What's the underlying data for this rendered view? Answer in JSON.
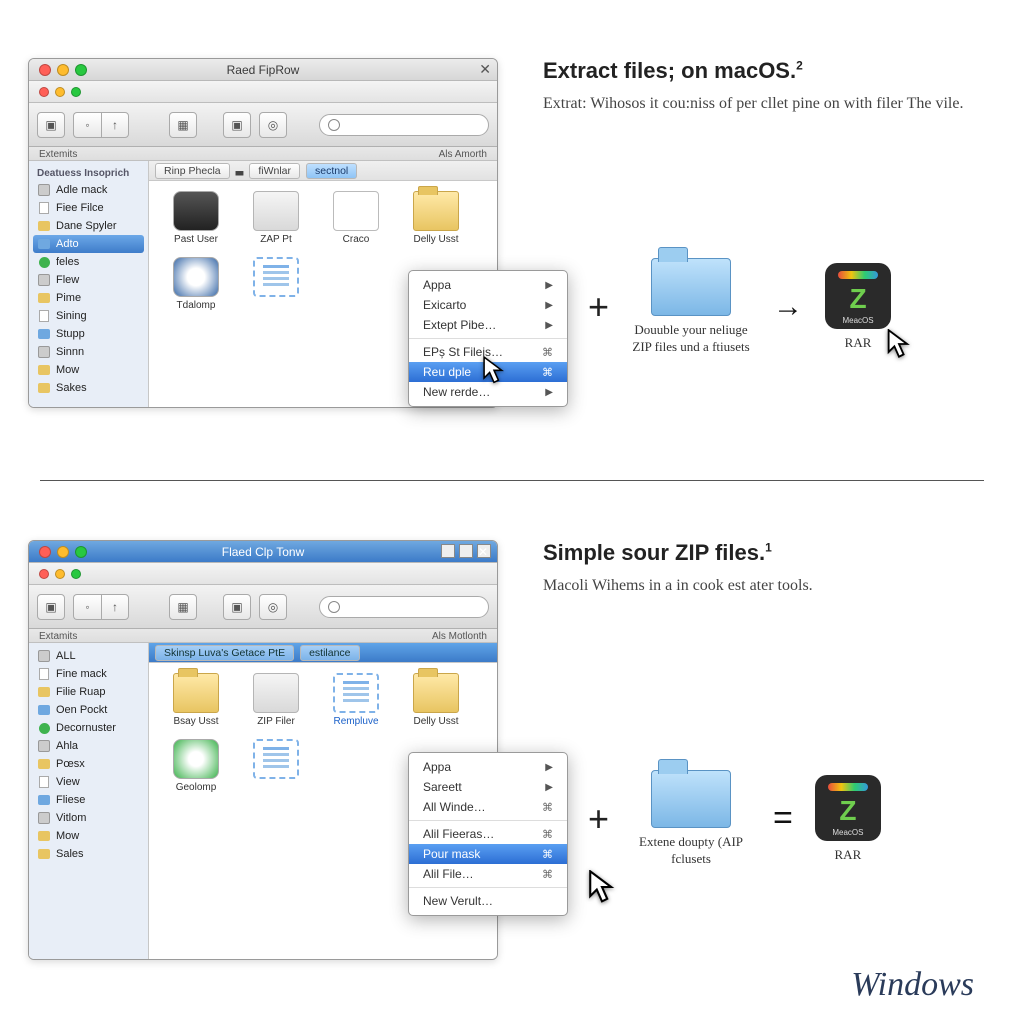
{
  "top": {
    "window": {
      "title": "Raed FipRow",
      "toolbar_left_label": "Extemits",
      "toolbar_right_label": "Als Amorth",
      "sidebar_header": "Deatuess Insoprich",
      "sidebar_items": [
        {
          "label": "Adle mack",
          "selected": false
        },
        {
          "label": "Fiee Filce",
          "selected": false
        },
        {
          "label": "Dane Spyler",
          "selected": false
        },
        {
          "label": "Adto",
          "selected": true
        },
        {
          "label": "feles",
          "selected": false
        },
        {
          "label": "Flew",
          "selected": false
        },
        {
          "label": "Pime",
          "selected": false
        },
        {
          "label": "Sining",
          "selected": false
        },
        {
          "label": "Stupp",
          "selected": false
        },
        {
          "label": "Sinnn",
          "selected": false
        },
        {
          "label": "Mow",
          "selected": false
        },
        {
          "label": "Sakes",
          "selected": false
        }
      ],
      "path": {
        "a": "Rinp Phecla",
        "b": "fiWnlar",
        "c": "sectnol"
      },
      "items": [
        {
          "label": "Past User"
        },
        {
          "label": "ZAP Pt"
        },
        {
          "label": "Craco"
        },
        {
          "label": "Delly Usst"
        },
        {
          "label": "Tdalomp"
        }
      ],
      "menu": [
        {
          "label": "Appa",
          "arrow": true
        },
        {
          "label": "Exicarto",
          "arrow": true
        },
        {
          "label": "Extept Pibe…",
          "arrow": true
        },
        {
          "label": "EPș St Fileis…",
          "sc": "⌘"
        },
        {
          "label": "Reu dple",
          "hl": true,
          "sc": "⌘"
        },
        {
          "label": "New rerde…",
          "arrow": true
        }
      ]
    },
    "annot": {
      "title": "Extract files; on  macOS.",
      "sup": "2",
      "body": "Extrat: Wihosos it cou:niss of per cllet pine on with filer The vile."
    },
    "equation": {
      "folder_caption": "Douuble your neliuge ZIP files und a ftiusets",
      "rar_badge": "MeacOS",
      "rar_label": "RAR"
    }
  },
  "bottom": {
    "window": {
      "title": "Flaed Clp Tonw",
      "toolbar_left_label": "Extamits",
      "toolbar_right_label": "Als Motlonth",
      "sidebar_items": [
        {
          "label": "ALL",
          "selected": false
        },
        {
          "label": "Fine mack",
          "selected": false
        },
        {
          "label": "Filie Ruap",
          "selected": false
        },
        {
          "label": "Oen Pockt",
          "selected": false
        },
        {
          "label": "Decornuster",
          "selected": false
        },
        {
          "label": "Ahla",
          "selected": false
        },
        {
          "label": "Pœsx",
          "selected": false
        },
        {
          "label": "View",
          "selected": false
        },
        {
          "label": "Fliese",
          "selected": false
        },
        {
          "label": "Vitlom",
          "selected": false
        },
        {
          "label": "Mow",
          "selected": false
        },
        {
          "label": "Sales",
          "selected": false
        }
      ],
      "path": {
        "a": "Skinsp Luva's Getace PtE",
        "b": "estilance"
      },
      "items": [
        {
          "label": "Bsay Usst"
        },
        {
          "label": "ZIP Filer"
        },
        {
          "label": "Rempluve"
        },
        {
          "label": "Delly Usst"
        },
        {
          "label": "Geolomp"
        }
      ],
      "menu": [
        {
          "label": "Appa",
          "arrow": true
        },
        {
          "label": "Sareett",
          "arrow": true
        },
        {
          "label": "All Winde…",
          "sc": "⌘"
        },
        {
          "label": "Alil Fieeras…",
          "sc": "⌘"
        },
        {
          "label": "Pour mask",
          "hl": true,
          "sc": "⌘"
        },
        {
          "label": "Alil File…",
          "sc": "⌘"
        },
        {
          "label": "New Verult…"
        }
      ]
    },
    "annot": {
      "title": "Simple sour ZIP files.",
      "sup": "1",
      "body": "Macoli Wihems in a in cook est ater tools."
    },
    "equation": {
      "folder_caption": "Extene doupty (AIP fclusets",
      "rar_badge": "MeacOS",
      "rar_label": "RAR"
    }
  },
  "brand": "Windows"
}
